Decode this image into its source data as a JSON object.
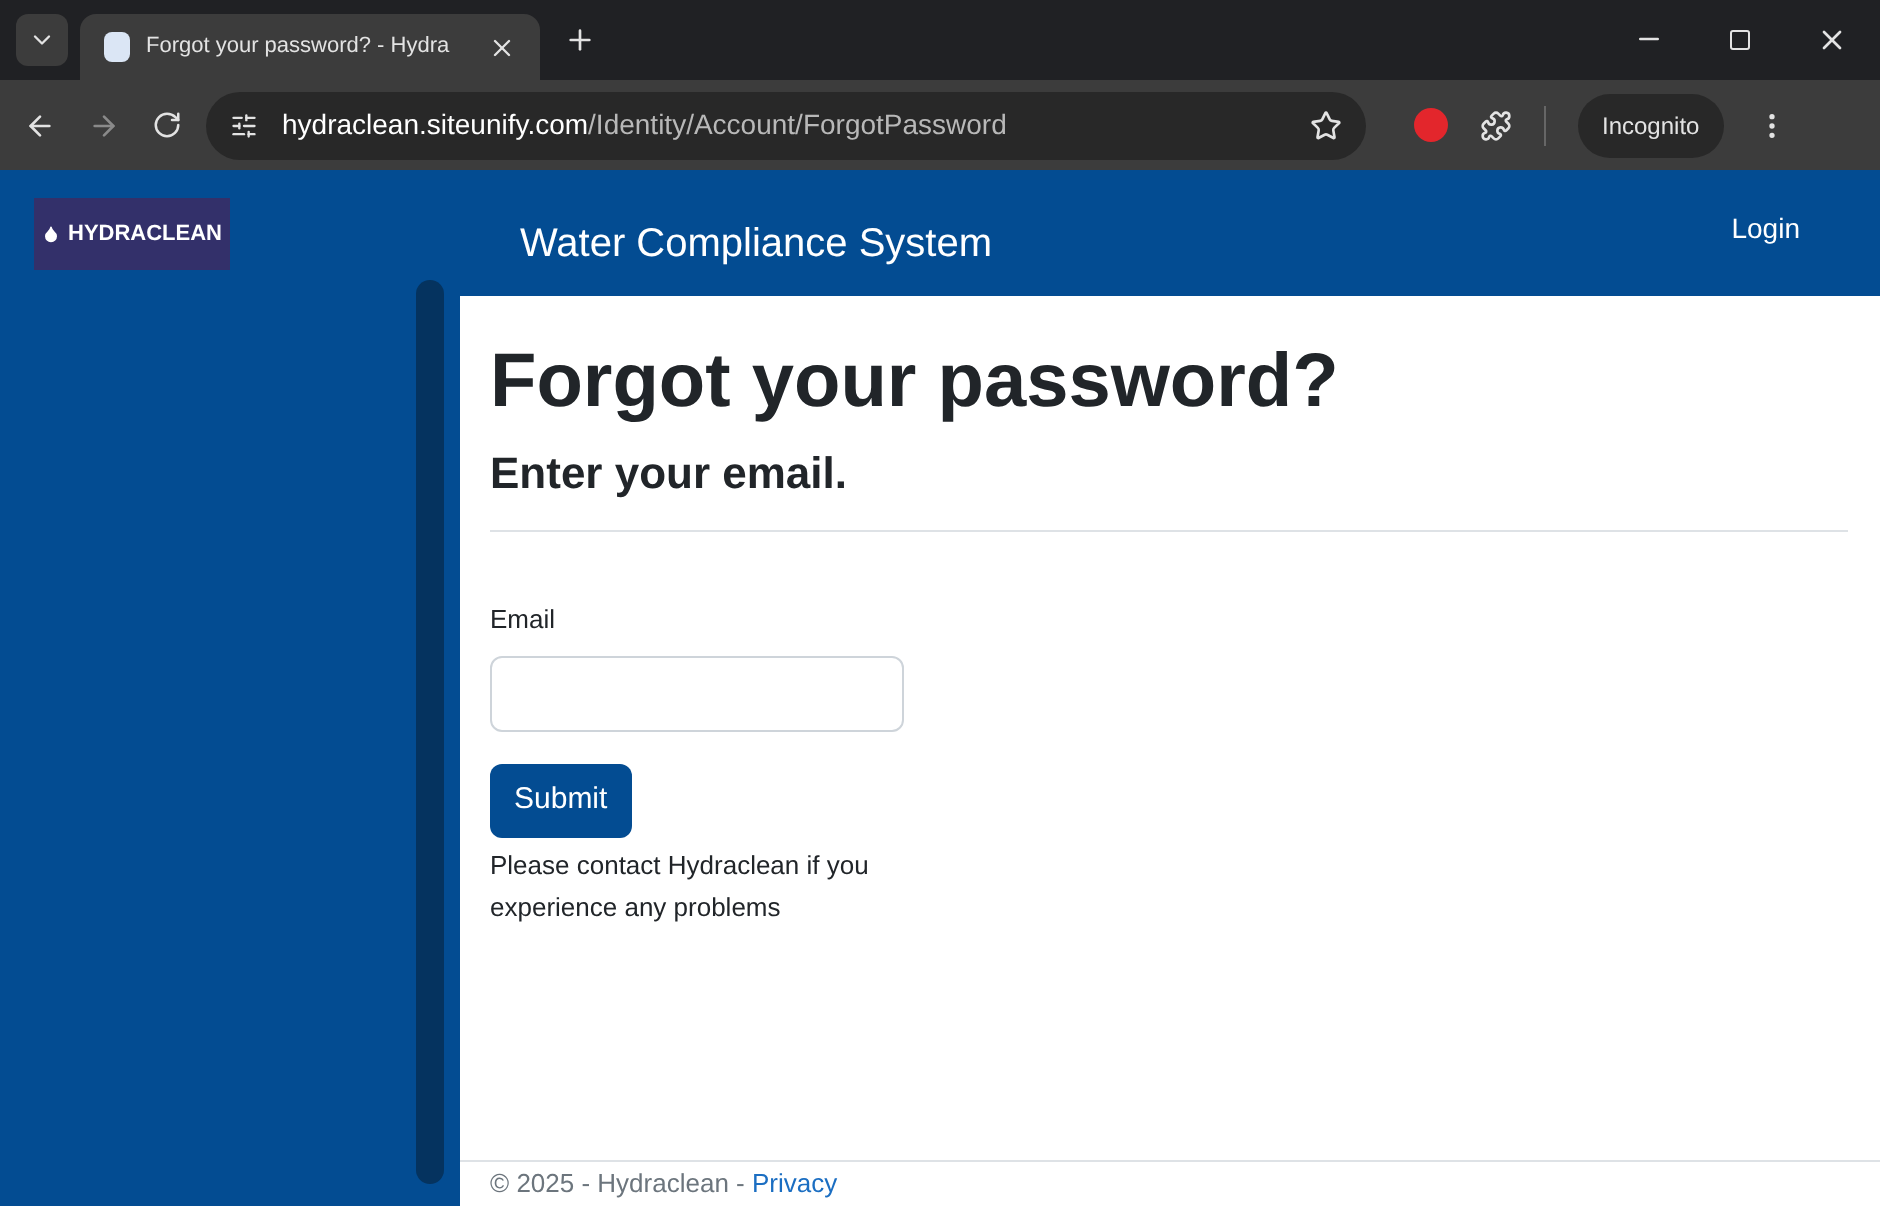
{
  "browser": {
    "tab_title": "Forgot your password? - Hydra",
    "url_host": "hydraclean.siteunify.com",
    "url_path": "/Identity/Account/ForgotPassword",
    "profile": "Incognito"
  },
  "header": {
    "logo": "HYDRACLEAN",
    "title": "Water Compliance System",
    "login": "Login"
  },
  "page": {
    "heading": "Forgot your password?",
    "subheading": "Enter your email.",
    "email_label": "Email",
    "submit": "Submit",
    "note": "Please contact Hydraclean if you experience any problems"
  },
  "footer": {
    "text": "© 2025 - Hydraclean - ",
    "link": "Privacy"
  }
}
